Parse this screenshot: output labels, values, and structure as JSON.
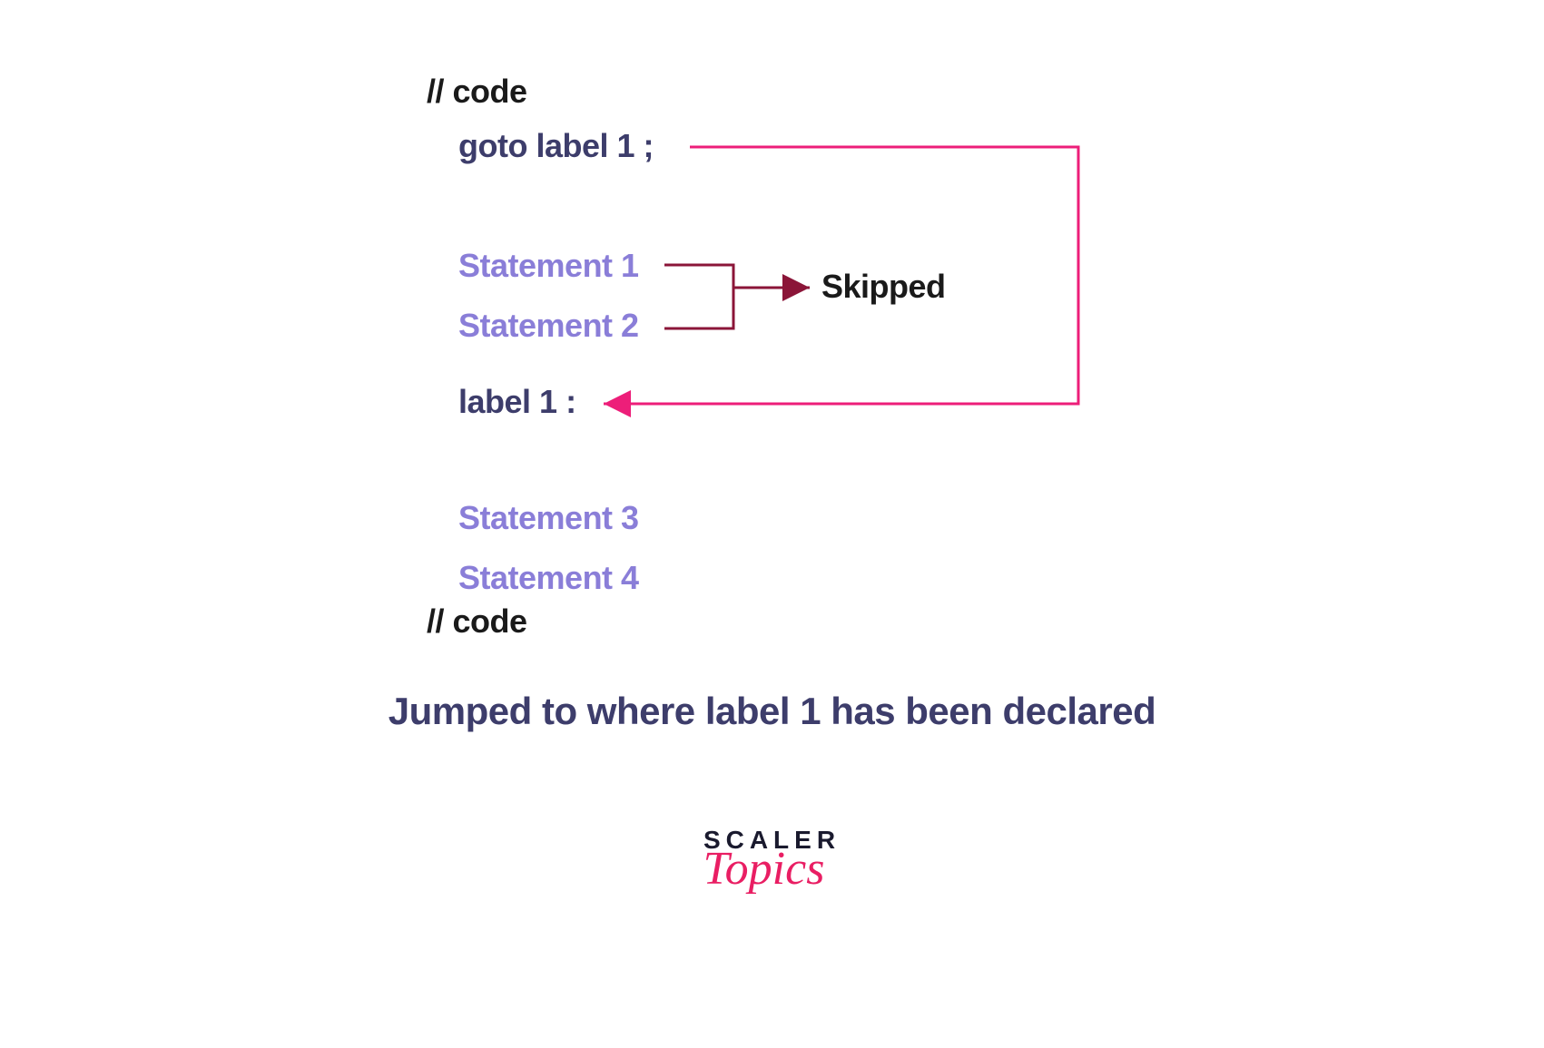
{
  "colors": {
    "dark_text": "#1a1a1a",
    "navy": "#3d3d6b",
    "purple": "#8a7ed8",
    "pink": "#ed1e79",
    "maroon": "#8b1538"
  },
  "code": {
    "comment_top": "// code",
    "goto_line": "goto label 1 ;",
    "statement1": "Statement 1",
    "statement2": "Statement 2",
    "label_line": "label 1 :",
    "statement3": "Statement 3",
    "statement4": "Statement 4",
    "comment_bottom": "// code"
  },
  "skipped_label": "Skipped",
  "caption": "Jumped to where label 1 has been declared",
  "logo": {
    "scaler": "SCALER",
    "topics": "Topics"
  }
}
